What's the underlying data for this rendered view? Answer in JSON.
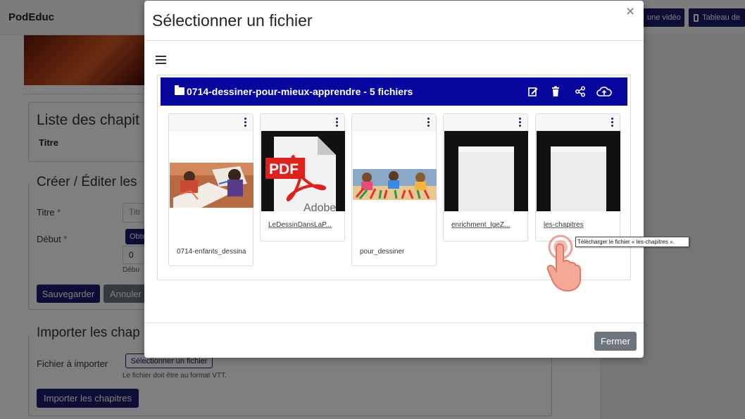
{
  "app": {
    "brand": "PodEduc",
    "top_buttons": [
      {
        "label": "une vidéo"
      },
      {
        "label": "Tableau de"
      }
    ]
  },
  "page": {
    "chapters_list": {
      "title": "Liste des chapit",
      "column_title": "Titre"
    },
    "edit_section": {
      "title": "Créer / Éditer les",
      "title_label": "Titre",
      "title_placeholder": "Titr",
      "start_label": "Début",
      "start_button": "Obte",
      "start_value": "0",
      "start_help": "Débu",
      "required_mark": "*",
      "save_label": "Sauvegarder",
      "cancel_label": "Annuler"
    },
    "import_section": {
      "title": "Importer les chap",
      "file_label": "Fichier à importer",
      "select_file_label": "Sélectionner un fichier",
      "help_text": "Le fichier doit être au format VTT.",
      "import_label": "Importer les chapitres"
    }
  },
  "modal": {
    "title": "Sélectionner un fichier",
    "close_glyph": "×",
    "folder": {
      "name": "0714-dessiner-pour-mieux-apprendre - 5 fichiers",
      "actions": [
        "edit-icon",
        "trash-icon",
        "share-icon",
        "cloud-upload-icon"
      ]
    },
    "files": [
      {
        "name": "0714-enfants_dessina",
        "kind": "image-children-drawing",
        "link": false
      },
      {
        "name": "LeDessinDansLaP...",
        "kind": "pdf",
        "link": true
      },
      {
        "name": "pour_dessiner",
        "kind": "image-colored-pencils",
        "link": false
      },
      {
        "name": "enrichment_IgeZ...",
        "kind": "blank-document",
        "link": true
      },
      {
        "name": "les-chapitres",
        "kind": "blank-document",
        "link": true
      }
    ],
    "pdf_badge": "PDF",
    "pdf_brand": "Adobe",
    "tooltip": "Télécharger le fichier « les-chapitres ».",
    "close_button": "Fermer"
  },
  "colors": {
    "accent": "#1a1a6b",
    "folder_bar": "#0707a0",
    "secondary": "#6c757d"
  }
}
